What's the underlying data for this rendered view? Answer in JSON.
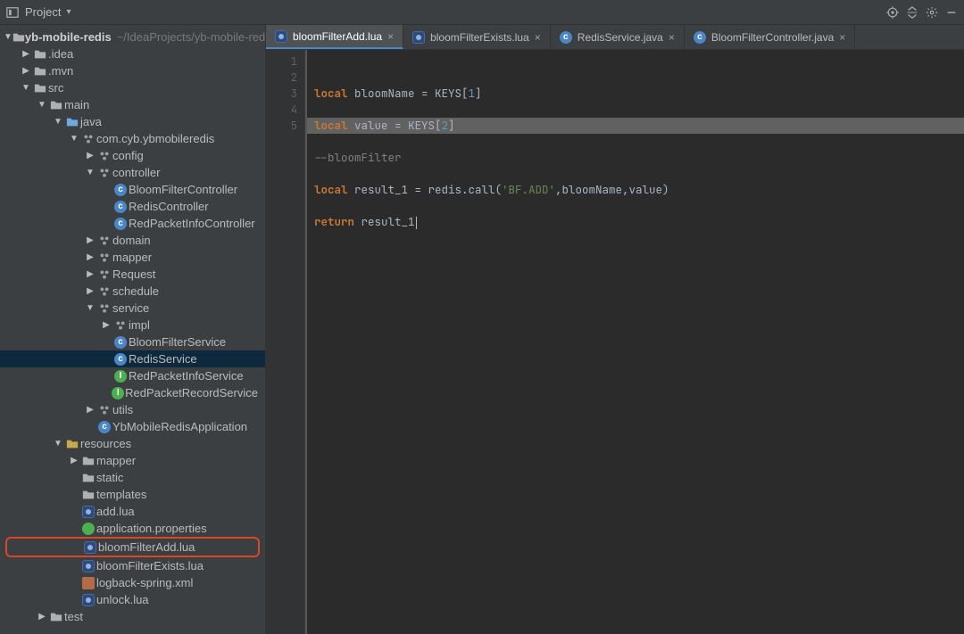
{
  "panel": {
    "title": "Project",
    "target_icon": "target-icon",
    "expand_icon": "expand-all-icon",
    "gear_icon": "settings-icon",
    "minimize_icon": "minimize-icon"
  },
  "project": {
    "root": "yb-mobile-redis",
    "root_hint": "~/IdeaProjects/yb-mobile-redis",
    "idea": ".idea",
    "mvn": ".mvn",
    "src": "src",
    "main": "main",
    "java": "java",
    "pkg": "com.cyb.ybmobileredis",
    "config": "config",
    "controller": "controller",
    "bloomController": "BloomFilterController",
    "redisController": "RedisController",
    "redPacketInfoController": "RedPacketInfoController",
    "domain": "domain",
    "mapper": "mapper",
    "request": "Request",
    "schedule": "schedule",
    "service": "service",
    "impl": "impl",
    "bloomService": "BloomFilterService",
    "redisService": "RedisService",
    "redPacketInfoService": "RedPacketInfoService",
    "redPacketRecordService": "RedPacketRecordService",
    "utils": "utils",
    "appClass": "YbMobileRedisApplication",
    "resources": "resources",
    "mapperRes": "mapper",
    "static": "static",
    "templates": "templates",
    "addLua": "add.lua",
    "appProps": "application.properties",
    "bloomAddLua": "bloomFilterAdd.lua",
    "bloomExistsLua": "bloomFilterExists.lua",
    "logback": "logback-spring.xml",
    "unlockLua": "unlock.lua",
    "test": "test"
  },
  "tabs": [
    {
      "label": "bloomFilterAdd.lua",
      "type": "lua",
      "active": true
    },
    {
      "label": "bloomFilterExists.lua",
      "type": "lua",
      "active": false
    },
    {
      "label": "RedisService.java",
      "type": "java",
      "active": false
    },
    {
      "label": "BloomFilterController.java",
      "type": "java",
      "active": false
    }
  ],
  "editor": {
    "lines": [
      "1",
      "2",
      "3",
      "4",
      "5"
    ],
    "code": {
      "l1_kw": "local",
      "l1_id": " bloomName = KEYS[",
      "l1_num": "1",
      "l1_end": "]",
      "l2_kw": "local",
      "l2_id": " value = KEYS[",
      "l2_num": "2",
      "l2_end": "]",
      "l3": "--bloomFilter",
      "l4_kw": "local",
      "l4_a": " result_1 = redis.call(",
      "l4_str": "'BF.ADD'",
      "l4_b": ",bloomName,value)",
      "l5_kw": "return",
      "l5_id": " result_1"
    }
  }
}
